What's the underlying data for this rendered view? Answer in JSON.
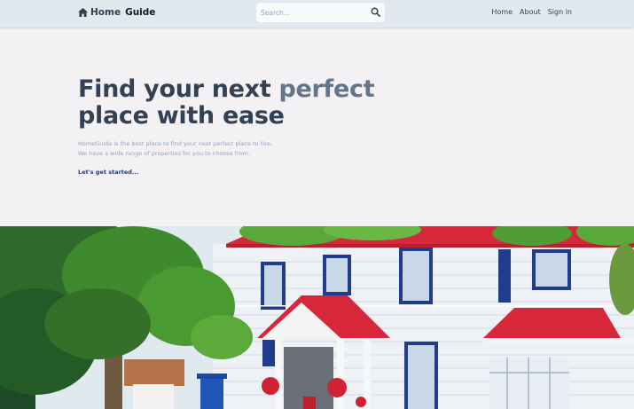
{
  "nav": {
    "brand": {
      "home_icon": "home-icon",
      "first": "Home",
      "second": "Guide"
    },
    "search": {
      "placeholder": "Search...",
      "icon": "search-icon"
    },
    "links": [
      "Home",
      "About",
      "Sign in"
    ]
  },
  "hero": {
    "title_part1": "Find your next ",
    "title_accent": "perfect",
    "title_part2": "place with ease",
    "description_line1": "HomeGuide is the best place to find your next perfect place to live.",
    "description_line2": "We have a wide range of properties for you to choose from.",
    "cta": "Let's get started..."
  },
  "colors": {
    "background": "#f4f1f5",
    "navbar": "#e2e8f0",
    "heading": "#334155",
    "accent": "#64748b",
    "cta": "#1e3a8a"
  }
}
